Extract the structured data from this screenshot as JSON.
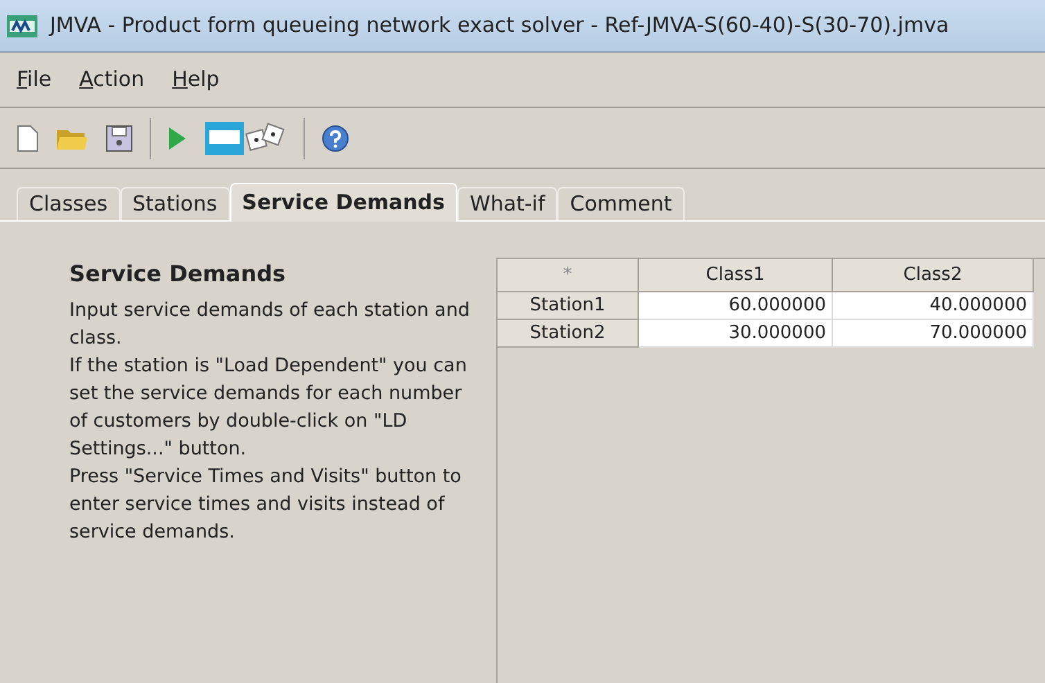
{
  "window": {
    "title": "JMVA - Product form queueing network exact solver - Ref-JMVA-S(60-40)-S(30-70).jmva"
  },
  "menu": [
    "File",
    "Action",
    "Help"
  ],
  "tabs": [
    {
      "label": "Classes",
      "selected": false
    },
    {
      "label": "Stations",
      "selected": false
    },
    {
      "label": "Service Demands",
      "selected": true
    },
    {
      "label": "What-if",
      "selected": false
    },
    {
      "label": "Comment",
      "selected": false
    }
  ],
  "panel": {
    "heading": "Service Demands",
    "paragraphs": [
      "Input service demands of each station and class.",
      "If the station is \"Load Dependent\" you can set the service demands for each number of customers by double-click on \"LD Settings...\" button.",
      "Press \"Service Times and Visits\" button to enter service times and visits instead of service demands."
    ]
  },
  "table": {
    "corner": "*",
    "columns": [
      "Class1",
      "Class2"
    ],
    "rows": [
      {
        "station": "Station1",
        "values": [
          "60.000000",
          "40.000000"
        ]
      },
      {
        "station": "Station2",
        "values": [
          "30.000000",
          "70.000000"
        ]
      }
    ]
  }
}
